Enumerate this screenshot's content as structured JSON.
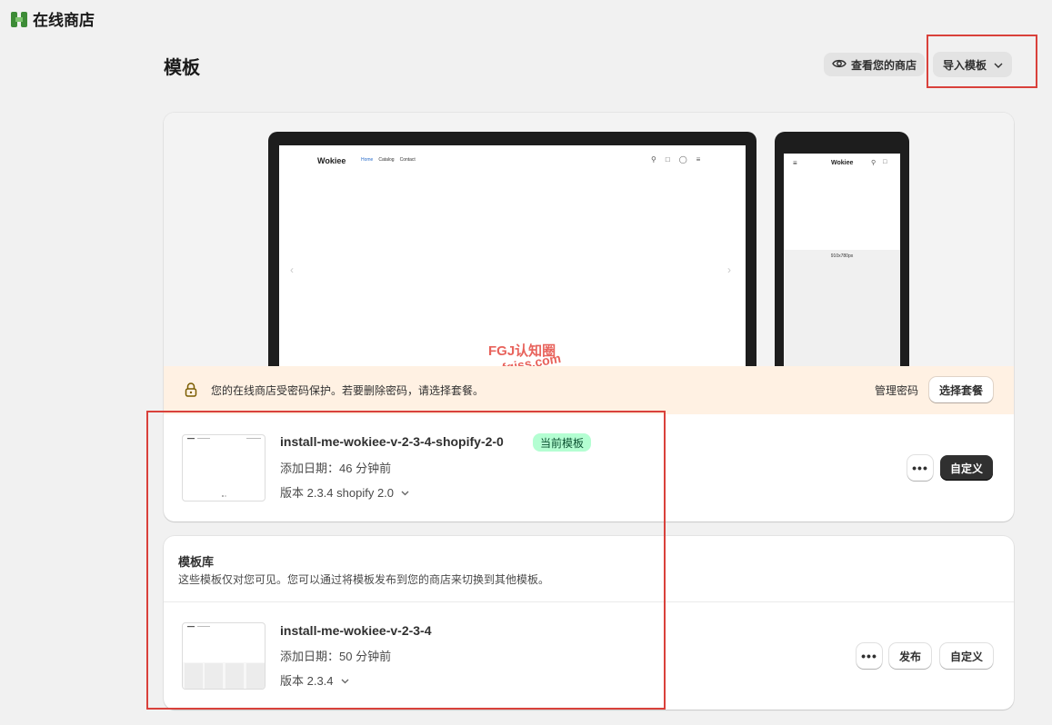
{
  "app": {
    "title": "在线商店"
  },
  "page": {
    "title": "模板"
  },
  "header": {
    "view_store_label": "查看您的商店",
    "import_theme_label": "导入模板"
  },
  "preview": {
    "desktop": {
      "logo": "Wokiee",
      "nav": [
        "Home",
        "Catalog",
        "Contact"
      ]
    },
    "mobile": {
      "logo": "Wokiee",
      "placeholder_size": "910x780px"
    },
    "watermark": {
      "line1": "FGJ认知圈",
      "line2": "nbv.fgjss.com"
    }
  },
  "password_banner": {
    "message": "您的在线商店受密码保护。若要删除密码，请选择套餐。",
    "manage_label": "管理密码",
    "choose_plan_label": "选择套餐"
  },
  "current_theme": {
    "name": "install-me-wokiee-v-2-3-4-shopify-2-0",
    "badge": "当前模板",
    "added": "添加日期：46 分钟前",
    "version": "版本 2.3.4 shopify 2.0",
    "more_label": "•••",
    "customize_label": "自定义"
  },
  "library": {
    "title": "模板库",
    "description": "这些模板仅对您可见。您可以通过将模板发布到您的商店来切换到其他模板。",
    "themes": [
      {
        "name": "install-me-wokiee-v-2-3-4",
        "added": "添加日期：50 分钟前",
        "version": "版本 2.3.4",
        "more_label": "•••",
        "publish_label": "发布",
        "customize_label": "自定义"
      }
    ]
  },
  "colors": {
    "highlight": "#d9413b",
    "badge_bg": "#b4fed2",
    "banner_bg": "#fff1e3",
    "primary_button": "#303030"
  }
}
